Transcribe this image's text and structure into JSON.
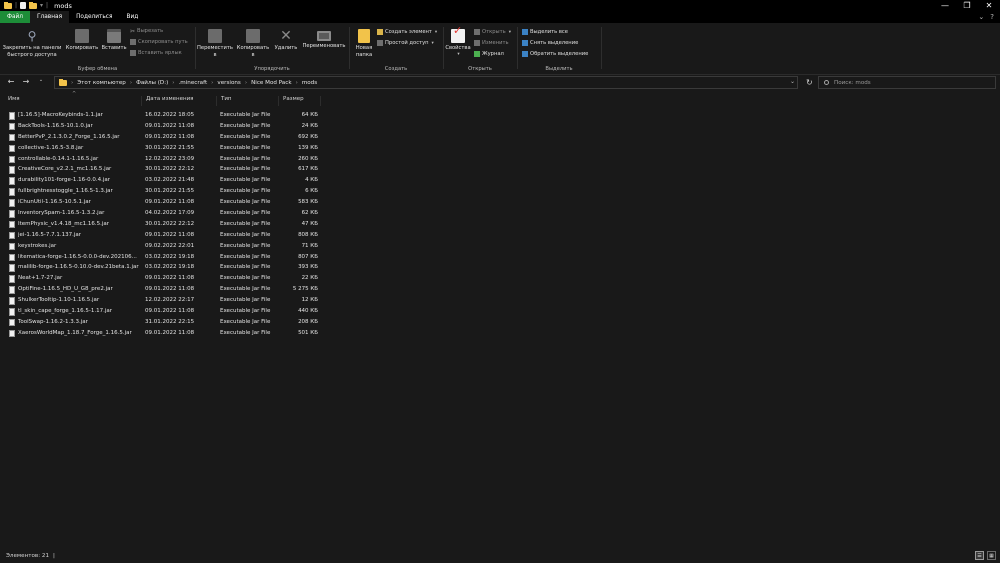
{
  "window": {
    "title": "mods",
    "controls": [
      "—",
      "❐",
      "✕"
    ]
  },
  "ribbon": {
    "tabs": [
      {
        "label": "Файл"
      },
      {
        "label": "Главная"
      },
      {
        "label": "Поделиться"
      },
      {
        "label": "Вид"
      }
    ],
    "clipboard": {
      "pin_l1": "Закрепить на панели",
      "pin_l2": "быстрого доступа",
      "copy": "Копировать",
      "paste": "Вставить",
      "cut": "Вырезать",
      "copy_path": "Скопировать путь",
      "paste_shortcut": "Вставить ярлык",
      "label": "Буфер обмена"
    },
    "organize": {
      "move_l1": "Переместить",
      "move_l2": "в",
      "copy_l1": "Копировать",
      "copy_l2": "в",
      "delete": "Удалить",
      "rename": "Переименовать",
      "label": "Упорядочить"
    },
    "create": {
      "new_folder_l1": "Новая",
      "new_folder_l2": "папка",
      "new_item": "Создать элемент",
      "easy_access": "Простой доступ",
      "label": "Создать"
    },
    "open": {
      "properties": "Свойства",
      "open": "Открыть",
      "edit": "Изменить",
      "history": "Журнал",
      "label": "Открыть"
    },
    "select": {
      "select_all": "Выделить все",
      "select_none": "Снять выделение",
      "invert": "Обратить выделение",
      "label": "Выделить"
    }
  },
  "address": {
    "crumbs": [
      "Этот компьютер",
      "Файлы (D:)",
      ".minecraft",
      "versions",
      "Nice Mod Pack",
      "mods"
    ],
    "search_placeholder": "Поиск: mods"
  },
  "columns": {
    "name": "Имя",
    "date": "Дата изменения",
    "type": "Тип",
    "size": "Размер"
  },
  "files": [
    {
      "name": "[1.16.5]-MacroKeybinds-1.1.jar",
      "date": "16.02.2022 18:05",
      "type": "Executable Jar File",
      "size": "64 КБ"
    },
    {
      "name": "BackTools-1.16.5-10.1.0.jar",
      "date": "09.01.2022 11:08",
      "type": "Executable Jar File",
      "size": "24 КБ"
    },
    {
      "name": "BetterPvP_2.1.3.0.2_Forge_1.16.5.jar",
      "date": "09.01.2022 11:08",
      "type": "Executable Jar File",
      "size": "692 КБ"
    },
    {
      "name": "collective-1.16.5-3.8.jar",
      "date": "30.01.2022 21:55",
      "type": "Executable Jar File",
      "size": "139 КБ"
    },
    {
      "name": "controllable-0.14.1-1.16.5.jar",
      "date": "12.02.2022 23:09",
      "type": "Executable Jar File",
      "size": "260 КБ"
    },
    {
      "name": "CreativeCore_v2.2.1_mc1.16.5.jar",
      "date": "30.01.2022 22:12",
      "type": "Executable Jar File",
      "size": "617 КБ"
    },
    {
      "name": "durability101-forge-1.16-0.0.4.jar",
      "date": "03.02.2022 21:48",
      "type": "Executable Jar File",
      "size": "4 КБ"
    },
    {
      "name": "fullbrightnesstoggle_1.16.5-1.3.jar",
      "date": "30.01.2022 21:55",
      "type": "Executable Jar File",
      "size": "6 КБ"
    },
    {
      "name": "iChunUtil-1.16.5-10.5.1.jar",
      "date": "09.01.2022 11:08",
      "type": "Executable Jar File",
      "size": "583 КБ"
    },
    {
      "name": "InventorySpam-1.16.5-1.3.2.jar",
      "date": "04.02.2022 17:09",
      "type": "Executable Jar File",
      "size": "62 КБ"
    },
    {
      "name": "ItemPhysic_v1.4.18_mc1.16.5.jar",
      "date": "30.01.2022 22:12",
      "type": "Executable Jar File",
      "size": "47 КБ"
    },
    {
      "name": "jei-1.16.5-7.7.1.137.jar",
      "date": "09.01.2022 11:08",
      "type": "Executable Jar File",
      "size": "808 КБ"
    },
    {
      "name": "keystrokes.jar",
      "date": "09.02.2022 22:01",
      "type": "Executable Jar File",
      "size": "71 КБ"
    },
    {
      "name": "litematica-forge-1.16.5-0.0.0-dev.202106...",
      "date": "03.02.2022 19:18",
      "type": "Executable Jar File",
      "size": "807 КБ"
    },
    {
      "name": "malilib-forge-1.16.5-0.10.0-dev.21beta.1.jar",
      "date": "03.02.2022 19:18",
      "type": "Executable Jar File",
      "size": "393 КБ"
    },
    {
      "name": "Neat+1.7-27.jar",
      "date": "09.01.2022 11:08",
      "type": "Executable Jar File",
      "size": "22 КБ"
    },
    {
      "name": "OptiFine-1.16.5_HD_U_G8_pre2.jar",
      "date": "09.01.2022 11:08",
      "type": "Executable Jar File",
      "size": "5 275 КБ"
    },
    {
      "name": "ShulkerTooltip-1.10-1.16.5.jar",
      "date": "12.02.2022 22:17",
      "type": "Executable Jar File",
      "size": "12 КБ"
    },
    {
      "name": "tl_skin_cape_forge_1.16.5-1.17.jar",
      "date": "09.01.2022 11:08",
      "type": "Executable Jar File",
      "size": "440 КБ"
    },
    {
      "name": "ToolSwap-1.16.2-1.3.3.jar",
      "date": "31.01.2022 22:15",
      "type": "Executable Jar File",
      "size": "208 КБ"
    },
    {
      "name": "XaerosWorldMap_1.18.7_Forge_1.16.5.jar",
      "date": "09.01.2022 11:08",
      "type": "Executable Jar File",
      "size": "501 КБ"
    }
  ],
  "status": {
    "items_label": "Элементов: 21",
    "divider": "|"
  },
  "colors": {
    "file_tab": "#1d8d38",
    "background": "#191919",
    "folder": "#f2c34a"
  }
}
